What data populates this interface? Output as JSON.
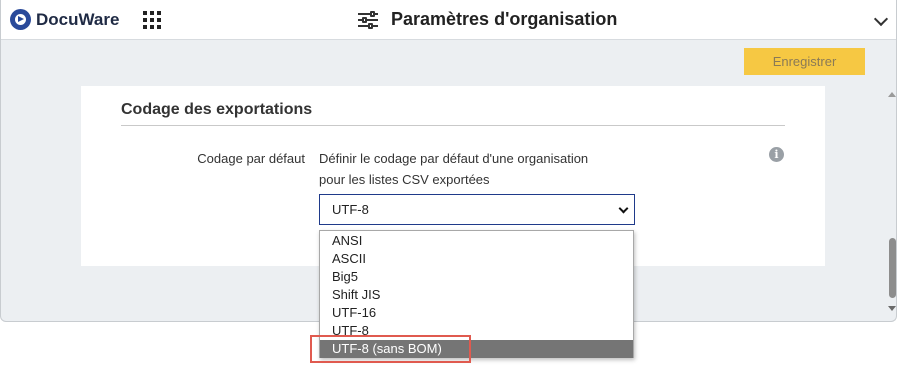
{
  "app": {
    "name": "DocuWare"
  },
  "header": {
    "title": "Paramètres d'organisation"
  },
  "toolbar": {
    "save_label": "Enregistrer"
  },
  "section": {
    "title": "Codage des exportations",
    "field_label": "Codage par défaut",
    "description_line1": "Définir le codage par défaut d'une organisation",
    "description_line2": "pour les listes CSV exportées",
    "info_glyph": "i"
  },
  "encoding_select": {
    "value": "UTF-8",
    "options": [
      "ANSI",
      "ASCII",
      "Big5",
      "Shift JIS",
      "UTF-16",
      "UTF-8",
      "UTF-8 (sans BOM)"
    ],
    "highlighted_option": "UTF-8 (sans BOM)"
  },
  "colors": {
    "brand": "#2a4a9a",
    "save_button": "#f6c843",
    "selected_option_bg": "#757575",
    "annotation_outline": "#e05a4f"
  }
}
